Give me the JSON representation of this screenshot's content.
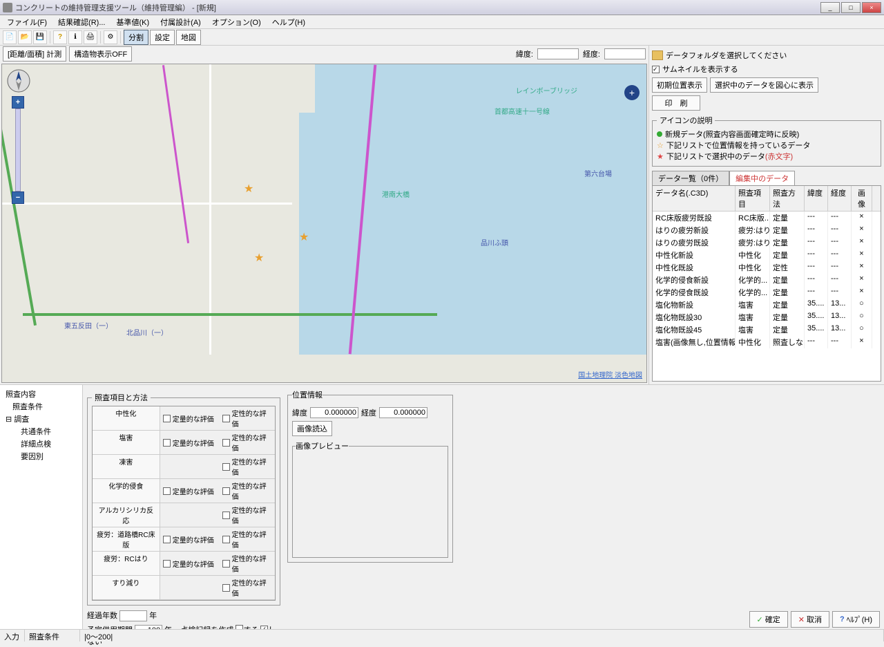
{
  "title": "コンクリートの維持管理支援ツール（維持管理編） - [新規]",
  "menus": [
    "ファイル(F)",
    "結果確認(R)...",
    "基準値(K)",
    "付属設計(A)",
    "オプション(O)",
    "ヘルプ(H)"
  ],
  "toolbar_toggles": [
    "分割",
    "設定",
    "地図"
  ],
  "map_header": {
    "measure_btn": "[距離/面積] 計測",
    "struct_btn": "構造物表示OFF",
    "lat_label": "緯度:",
    "lon_label": "経度:",
    "lat_val": "",
    "lon_val": ""
  },
  "map_labels": {
    "rainbow": "レインボーブリッジ",
    "shuto": "首都高速十一号線",
    "daiba": "第六台場",
    "konan": "港南大橋",
    "kitashinagawa": "北品川（一）",
    "higashi": "東五反田（一）",
    "shinagawa_futo": "品川ふ頭"
  },
  "map_attrib": "国土地理院 淡色地図",
  "right_pane": {
    "select_folder": "データフォルダを選択してください",
    "thumbnail_chk": "サムネイルを表示する",
    "btn_initial": "初期位置表示",
    "btn_center": "選択中のデータを図心に表示",
    "btn_print": "印　刷",
    "legend_title": "アイコンの説明",
    "legend1": "新規データ(照査内容画面確定時に反映)",
    "legend2": "下記リストで位置情報を持っているデータ",
    "legend3": "下記リストで選択中のデータ",
    "legend3_suffix": "(赤文字)",
    "tab1": "データ一覧（0件）",
    "tab2": "編集中のデータ",
    "cols": [
      "データ名(.C3D)",
      "照査項目",
      "照査方法",
      "緯度",
      "経度",
      "画像"
    ],
    "rows": [
      {
        "n": "RC床版疲労既設",
        "i": "RC床版...",
        "m": "定量",
        "lat": "---",
        "lon": "---",
        "img": "×"
      },
      {
        "n": "はりの疲労新設",
        "i": "疲労:はり",
        "m": "定量",
        "lat": "---",
        "lon": "---",
        "img": "×"
      },
      {
        "n": "はりの疲労既設",
        "i": "疲労:はり",
        "m": "定量",
        "lat": "---",
        "lon": "---",
        "img": "×"
      },
      {
        "n": "中性化新設",
        "i": "中性化",
        "m": "定量",
        "lat": "---",
        "lon": "---",
        "img": "×"
      },
      {
        "n": "中性化既設",
        "i": "中性化",
        "m": "定性",
        "lat": "---",
        "lon": "---",
        "img": "×"
      },
      {
        "n": "化学的侵食新設",
        "i": "化学的...",
        "m": "定量",
        "lat": "---",
        "lon": "---",
        "img": "×"
      },
      {
        "n": "化学的侵食既設",
        "i": "化学的...",
        "m": "定量",
        "lat": "---",
        "lon": "---",
        "img": "×"
      },
      {
        "n": "塩化物新設",
        "i": "塩害",
        "m": "定量",
        "lat": "35....",
        "lon": "13...",
        "img": "○"
      },
      {
        "n": "塩化物既設30",
        "i": "塩害",
        "m": "定量",
        "lat": "35....",
        "lon": "13...",
        "img": "○"
      },
      {
        "n": "塩化物既設45",
        "i": "塩害",
        "m": "定量",
        "lat": "35....",
        "lon": "13...",
        "img": "○"
      },
      {
        "n": "塩害(画像無し,位置情報有り)",
        "i": "中性化",
        "m": "照査しない",
        "lat": "---",
        "lon": "---",
        "img": "×"
      }
    ]
  },
  "tree": {
    "t1": "照査内容",
    "t2": "照査条件",
    "t3": "調査",
    "t4": "共通条件",
    "t5": "詳細点検",
    "t6": "要因別"
  },
  "form": {
    "fieldset_title": "照査項目と方法",
    "rows": [
      "中性化",
      "塩害",
      "凍害",
      "化学的侵食",
      "アルカリシリカ反応",
      "疲労：道路橋RC床版",
      "疲労：RCはり",
      "すり減り"
    ],
    "quant": "定量的な評価",
    "qual": "定性的な評価",
    "years_label": "経過年数",
    "years_val": "",
    "years_unit": "年",
    "service_label": "予定供用期間",
    "service_val": "100",
    "service_unit": "年",
    "create_label": "点検記録を作成",
    "opt_yes": "する",
    "opt_no": "しない"
  },
  "loc": {
    "title": "位置情報",
    "lat": "緯度",
    "lon": "経度",
    "lat_v": "0.000000",
    "lon_v": "0.000000",
    "load_btn": "画像読込",
    "preview": "画像プレビュー"
  },
  "btns": {
    "ok": "確定",
    "cancel": "取消",
    "help": "ﾍﾙﾌﾟ(H)"
  },
  "status": {
    "s1": "入力",
    "s2": "照査条件",
    "s3": "|0～200|"
  }
}
